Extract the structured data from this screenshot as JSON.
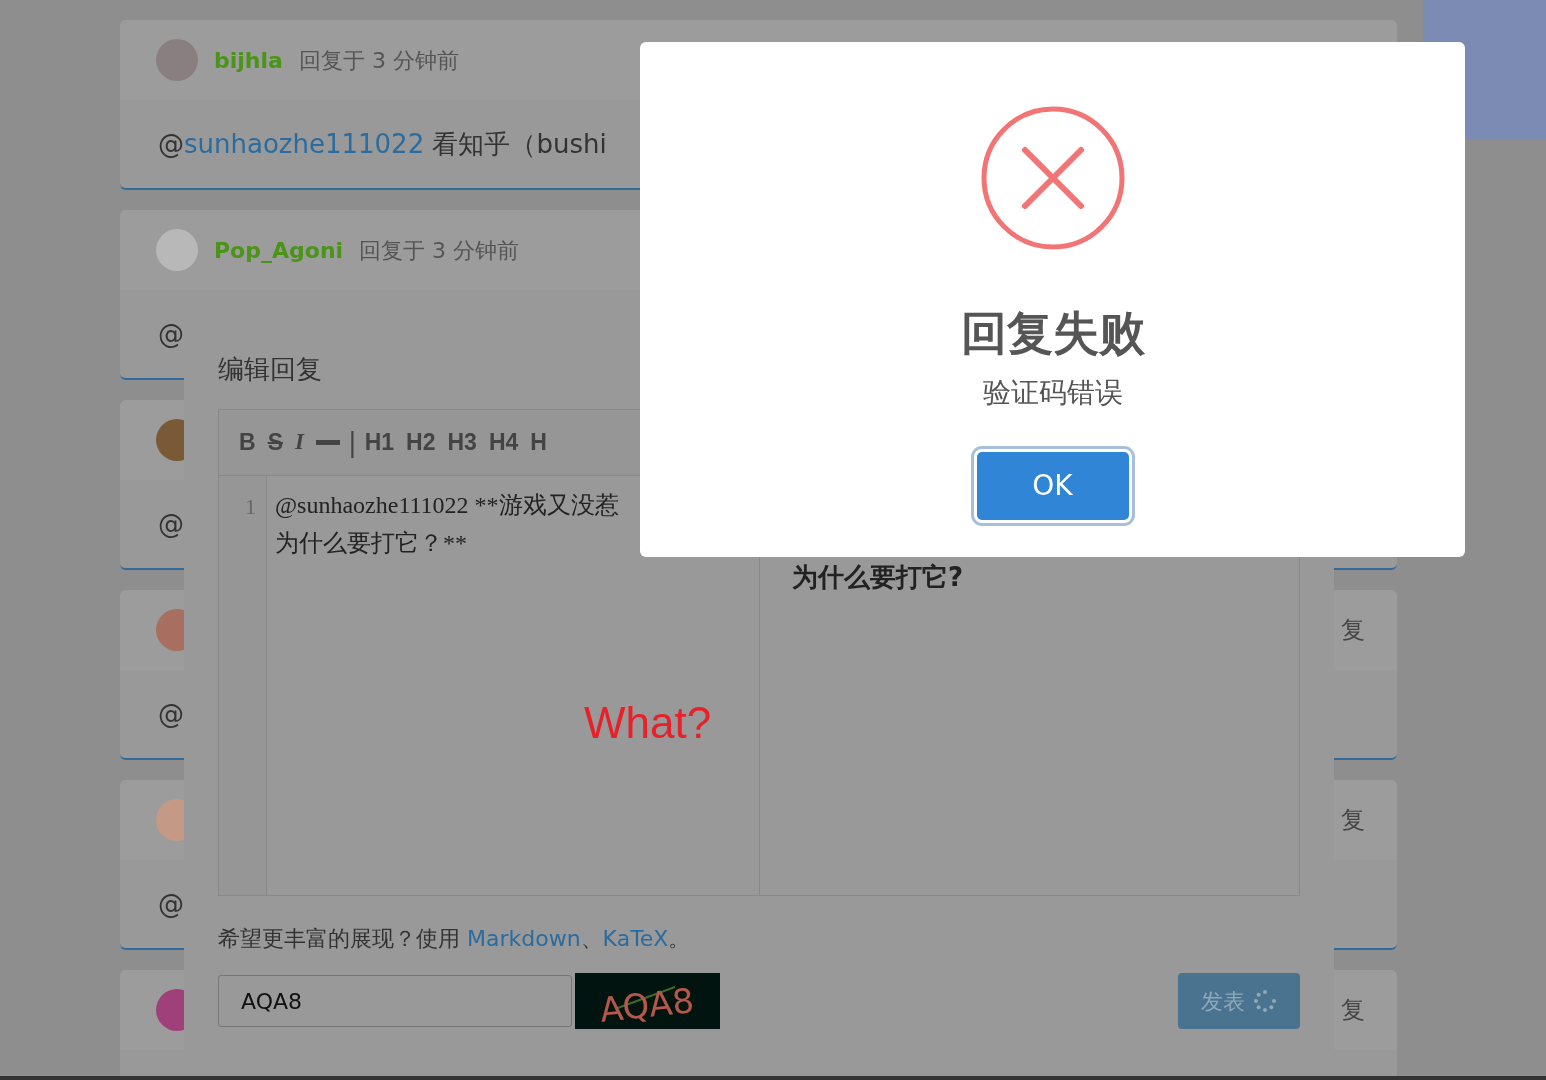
{
  "comments": [
    {
      "user": "bijhla",
      "time": "回复于 3 分钟前",
      "body_prefix": "@",
      "mention": "sunhaozhe111022",
      "body_text": " 看知乎（bushi"
    },
    {
      "user": "Pop_Agoni",
      "time": "回复于 3 分钟前",
      "body_prefix": "@"
    },
    {
      "body_prefix": "@"
    },
    {
      "body_prefix": "@",
      "reply": "复"
    },
    {
      "body_prefix": "@",
      "reply": "复"
    },
    {
      "reply": "复"
    }
  ],
  "editor_dialog": {
    "title": "编辑回复",
    "toolbar": [
      {
        "kind": "bold",
        "label": "B"
      },
      {
        "kind": "strike",
        "label": "S"
      },
      {
        "kind": "italic",
        "label": "I"
      },
      {
        "kind": "rule"
      },
      {
        "kind": "divider",
        "label": "|"
      },
      {
        "kind": "heading",
        "label": "H1"
      },
      {
        "kind": "heading",
        "label": "H2"
      },
      {
        "kind": "heading",
        "label": "H3"
      },
      {
        "kind": "heading",
        "label": "H4"
      },
      {
        "kind": "heading",
        "label": "H"
      }
    ],
    "source": {
      "line_number": "1",
      "wrapped_lines": [
        "@sunhaozhe111022 **游戏又没惹",
        "为什么要打它？**"
      ]
    },
    "preview": {
      "text": "为什么要打它?"
    },
    "hint": {
      "text": "希望更丰富的展现？使用 ",
      "links": [
        "Markdown",
        "KaTeX"
      ],
      "separator": "、",
      "end": "。"
    },
    "captcha": {
      "value": "AQA8",
      "image_text": "AQA8"
    },
    "submit": {
      "label": "发表",
      "loading": true
    },
    "annotation": {
      "text": "What?"
    }
  },
  "alert": {
    "kind": "error",
    "title": "回复失败",
    "text": "验证码错误",
    "button": "OK"
  }
}
